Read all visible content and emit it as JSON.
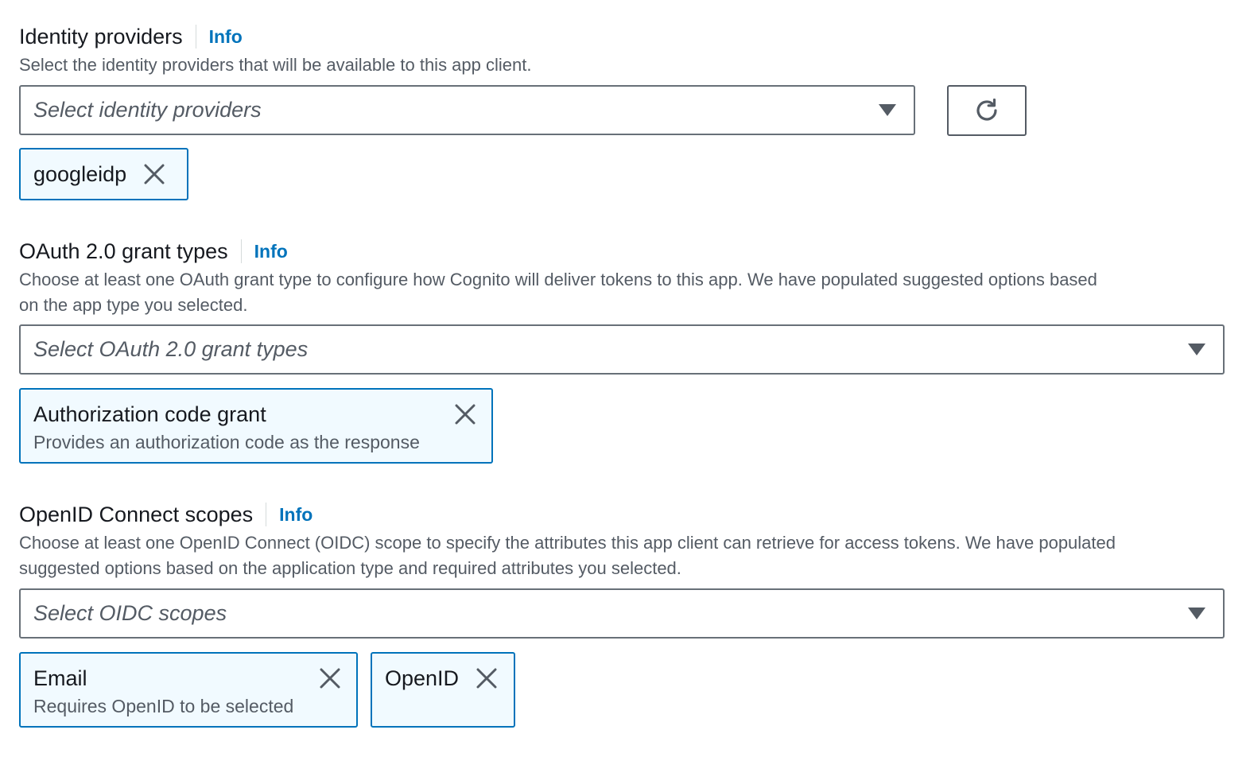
{
  "identity_providers": {
    "label": "Identity providers",
    "info": "Info",
    "description": "Select the identity providers that will be available to this app client.",
    "placeholder": "Select identity providers",
    "selected": [
      {
        "title": "googleidp"
      }
    ]
  },
  "grant_types": {
    "label": "OAuth 2.0 grant types",
    "info": "Info",
    "description_line1": "Choose at least one OAuth grant type to configure how Cognito will deliver tokens to this app. We have populated suggested options based",
    "description_line2": "on the app type you selected.",
    "placeholder": "Select OAuth 2.0 grant types",
    "selected": [
      {
        "title": "Authorization code grant",
        "description": "Provides an authorization code as the response"
      }
    ]
  },
  "oidc_scopes": {
    "label": "OpenID Connect scopes",
    "info": "Info",
    "description_line1": "Choose at least one OpenID Connect (OIDC) scope to specify the attributes this app client can retrieve for access tokens. We have populated",
    "description_line2": "suggested options based on the application type and required attributes you selected.",
    "placeholder": "Select OIDC scopes",
    "selected": [
      {
        "title": "Email",
        "description": "Requires OpenID to be selected"
      },
      {
        "title": "OpenID"
      }
    ]
  },
  "icons": {
    "caret": "caret-down-icon",
    "refresh": "refresh-icon",
    "remove": "close-icon"
  },
  "colors": {
    "accent": "#0073bb",
    "token_bg": "#f1faff",
    "text": "#16191f",
    "secondary_text": "#545b64"
  }
}
